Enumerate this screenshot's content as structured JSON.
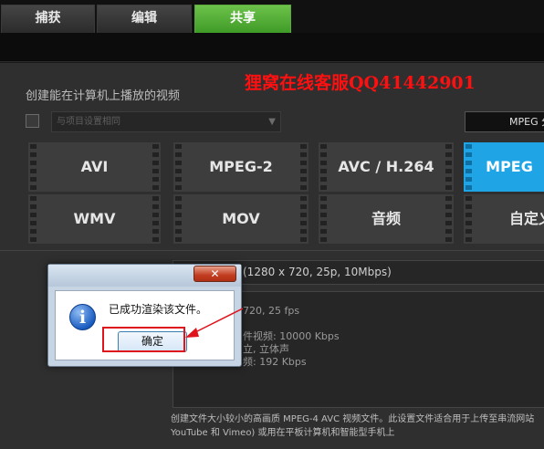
{
  "tabs": [
    {
      "label": "捕获",
      "active": false
    },
    {
      "label": "编辑",
      "active": false
    },
    {
      "label": "共享",
      "active": true
    }
  ],
  "watermark": "狸窝在线客服QQ41442901",
  "section_title": "创建能在计算机上播放的视频",
  "dropdown": {
    "value": "与项目设置相同"
  },
  "side_select": {
    "value": "MPEG 分"
  },
  "formats": [
    "AVI",
    "MPEG-2",
    "AVC / H.264",
    "MPEG",
    "WMV",
    "MOV",
    "音频",
    "自定义"
  ],
  "selected_format": "MPEG",
  "preset": {
    "value": "(1280 x 720, 25p, 10Mbps)"
  },
  "details": {
    "line1": "720, 25 fps",
    "line2": "件视频: 10000 Kbps",
    "line3": "立, 立体声",
    "line4": "频: 192 Kbps"
  },
  "description": {
    "line1": "创建文件大小较小的高画质 MPEG-4 AVC 视频文件。此设置文件适合用于上传至串流网站",
    "line2": "YouTube 和 Vimeo) 或用在平板计算机和智能型手机上"
  },
  "dialog": {
    "message": "已成功渲染该文件。",
    "ok_label": "确定",
    "close_label": "✕",
    "info_glyph": "i"
  },
  "colors": {
    "active_tab": "#4aa82e",
    "selected_format": "#1fa4e6",
    "watermark": "#ff1010",
    "highlight_frame": "#e0141c"
  },
  "icons": [
    "info-icon",
    "close-icon",
    "chevron-down-icon",
    "annotation-arrow-icon"
  ]
}
